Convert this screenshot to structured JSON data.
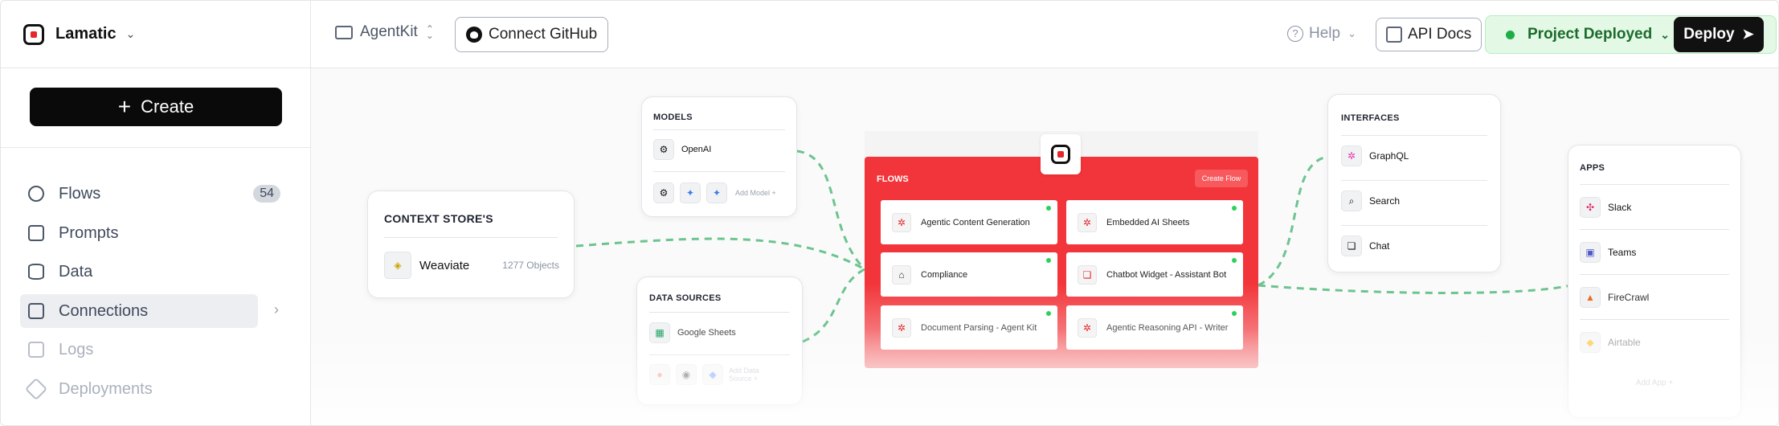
{
  "header": {
    "brand": "Lamatic",
    "project": "AgentKit",
    "connect_github": "Connect GitHub",
    "help": "Help",
    "api_docs": "API Docs",
    "status": "Project Deployed",
    "deploy": "Deploy"
  },
  "sidebar": {
    "create": "Create",
    "items": [
      {
        "label": "Flows",
        "badge": "54"
      },
      {
        "label": "Prompts"
      },
      {
        "label": "Data"
      },
      {
        "label": "Connections"
      },
      {
        "label": "Logs"
      },
      {
        "label": "Deployments"
      }
    ]
  },
  "canvas": {
    "context_store": {
      "title": "CONTEXT STORE'S",
      "item": "Weaviate",
      "count": "1277 Objects"
    },
    "models": {
      "title": "MODELS",
      "item": "OpenAI",
      "add": "Add Model +"
    },
    "data_sources": {
      "title": "DATA SOURCES",
      "item": "Google Sheets",
      "add": "Add Data Source +"
    },
    "flows": {
      "title": "FLOWS",
      "create": "Create Flow",
      "items": [
        "Agentic Content Generation",
        "Embedded AI Sheets",
        "Compliance",
        "Chatbot Widget - Assistant Bot",
        "Document Parsing - Agent Kit",
        "Agentic Reasoning API - Writer"
      ]
    },
    "interfaces": {
      "title": "INTERFACES",
      "items": [
        "GraphQL",
        "Search",
        "Chat"
      ]
    },
    "apps": {
      "title": "APPS",
      "items": [
        "Slack",
        "Teams",
        "FireCrawl",
        "Airtable"
      ],
      "add": "Add App +"
    }
  },
  "colors": {
    "accent": "#f2353a",
    "link": "#6cc48f",
    "deployed_bg": "#e3f9e5"
  }
}
